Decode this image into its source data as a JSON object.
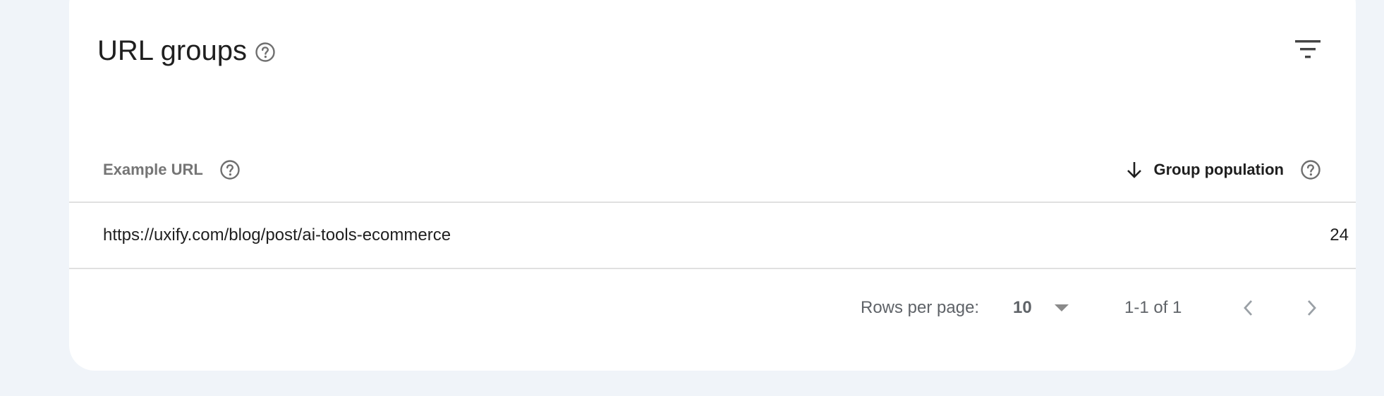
{
  "panel": {
    "title": "URL groups",
    "title_help_icon": "help-circle-icon",
    "filter_icon": "filter-list-icon"
  },
  "table": {
    "columns": [
      {
        "label": "Example URL",
        "icon": "help-circle-icon"
      },
      {
        "label": "Group population",
        "sort": "descending",
        "sort_icon": "arrow-down-icon",
        "icon": "help-circle-icon"
      }
    ],
    "rows": [
      {
        "url": "https://uxify.com/blog/post/ai-tools-ecommerce",
        "population": "24"
      }
    ]
  },
  "pagination": {
    "rows_per_page_label": "Rows per page:",
    "rows_per_page_value": "10",
    "range_label": "1-1 of 1",
    "prev_icon": "chevron-left-icon",
    "next_icon": "chevron-right-icon"
  },
  "colors": {
    "page_background": "#f0f4f9",
    "card_background": "#ffffff",
    "divider": "#e0e0e0",
    "primary_text": "#1f1f1f",
    "secondary_text": "#5f6368",
    "muted_header": "#757575"
  }
}
